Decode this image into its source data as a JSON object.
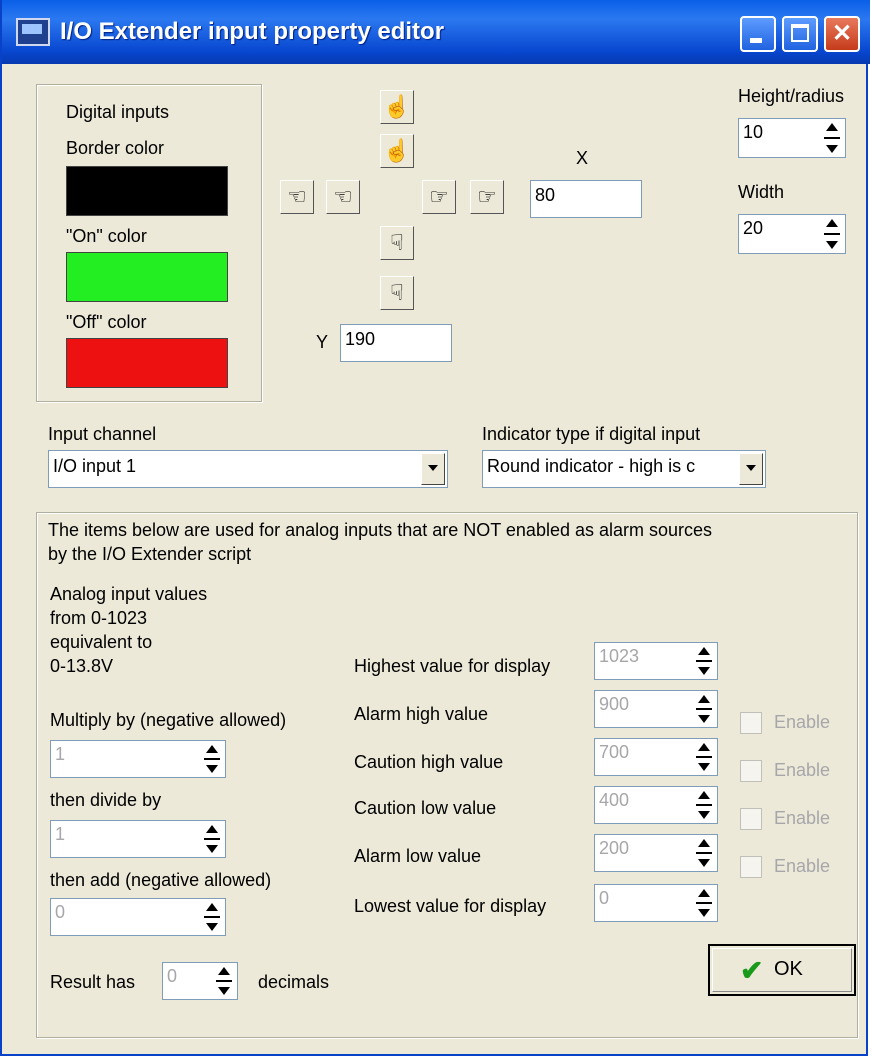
{
  "window": {
    "title": "I/O Extender input property editor"
  },
  "colors": {
    "label": "Digital inputs",
    "border_label": "Border color",
    "border_color": "#000000",
    "on_label": "\"On\" color",
    "on_color": "#22ee22",
    "off_label": "\"Off\" color",
    "off_color": "#ee1111"
  },
  "position": {
    "x_label": "X",
    "x_value": "80",
    "y_label": "Y",
    "y_value": "190"
  },
  "size": {
    "height_label": "Height/radius",
    "height_value": "10",
    "width_label": "Width",
    "width_value": "20"
  },
  "channel": {
    "label": "Input channel",
    "value": "I/O input 1"
  },
  "indicator": {
    "label": "Indicator type if digital input",
    "value": "Round indicator - high is c"
  },
  "analog": {
    "note": "The items below are used for analog inputs that are NOT enabled as alarm sources",
    "note2": "by the I/O Extender script",
    "info1": "Analog input values",
    "info2": "from 0-1023",
    "info3": "equivalent to",
    "info4": "0-13.8V",
    "multiply_label": "Multiply by (negative allowed)",
    "multiply_value": "1",
    "divide_label": "then divide by",
    "divide_value": "1",
    "add_label": "then add (negative allowed)",
    "add_value": "0",
    "result_label": "Result has",
    "result_value": "0",
    "decimals_label": "decimals"
  },
  "thresholds": {
    "highest_label": "Highest value for display",
    "highest_value": "1023",
    "alarm_high_label": "Alarm high value",
    "alarm_high_value": "900",
    "caution_high_label": "Caution high value",
    "caution_high_value": "700",
    "caution_low_label": "Caution low  value",
    "caution_low_value": "400",
    "alarm_low_label": "Alarm low value",
    "alarm_low_value": "200",
    "lowest_label": "Lowest value for display",
    "lowest_value": "0",
    "enable_label": "Enable"
  },
  "ok": {
    "label": "OK"
  }
}
